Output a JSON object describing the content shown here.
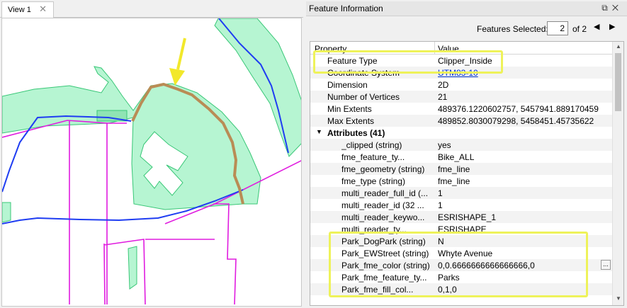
{
  "view": {
    "tab_label": "View 1",
    "close_glyph": "✕"
  },
  "panel": {
    "title": "Feature Information",
    "restore_icon": "restore-icon",
    "close_icon": "close-icon"
  },
  "selection": {
    "label": "Features Selected:",
    "value": "2",
    "of_label": "of 2",
    "prev_glyph": "◀",
    "next_glyph": "▶"
  },
  "table": {
    "col_property": "Property",
    "col_value": "Value",
    "rows": [
      {
        "property": "Feature Type",
        "value": "Clipper_Inside",
        "indent": 1
      },
      {
        "property": "Coordinate System",
        "value": "UTM83-10",
        "indent": 1,
        "link": true
      },
      {
        "property": "Dimension",
        "value": "2D",
        "indent": 1
      },
      {
        "property": "Number of Vertices",
        "value": "21",
        "indent": 1
      },
      {
        "property": "Min Extents",
        "value": "489376.1220602757, 5457941.889170459",
        "indent": 1
      },
      {
        "property": "Max Extents",
        "value": "489852.8030079298, 5458451.45735622",
        "indent": 1
      },
      {
        "property": "Attributes (41)",
        "value": "",
        "indent": 1,
        "group": true
      },
      {
        "property": "_clipped (string)",
        "value": "yes",
        "indent": 2
      },
      {
        "property": "fme_feature_ty...",
        "value": "Bike_ALL",
        "indent": 2
      },
      {
        "property": "fme_geometry (string)",
        "value": "fme_line",
        "indent": 2
      },
      {
        "property": "fme_type (string)",
        "value": "fme_line",
        "indent": 2
      },
      {
        "property": "multi_reader_full_id (...",
        "value": "1",
        "indent": 2
      },
      {
        "property": "multi_reader_id (32 ...",
        "value": "1",
        "indent": 2
      },
      {
        "property": "multi_reader_keywo...",
        "value": "ESRISHAPE_1",
        "indent": 2
      },
      {
        "property": "multi_reader_ty...",
        "value": "ESRISHAPE",
        "indent": 2
      },
      {
        "property": "Park_DogPark (string)",
        "value": "N",
        "indent": 2
      },
      {
        "property": "Park_EWStreet (string)",
        "value": "Whyte Avenue",
        "indent": 2
      },
      {
        "property": "Park_fme_color (string)",
        "value": "0,0.6666666666666666,0",
        "indent": 2,
        "ellipsis": true
      },
      {
        "property": "Park_fme_feature_ty...",
        "value": "Parks",
        "indent": 2
      },
      {
        "property": "Park_fme_fill_col...",
        "value": "0,1,0",
        "indent": 2
      }
    ],
    "ellipsis_label": "..."
  },
  "colors": {
    "park_fill": "#b6f5d2",
    "park_stroke": "#39c777",
    "road_blue": "#1f3df2",
    "boundary_magenta": "#e01cdf",
    "selected_line": "#b98c55",
    "highlight_yellow": "#eef25a"
  }
}
